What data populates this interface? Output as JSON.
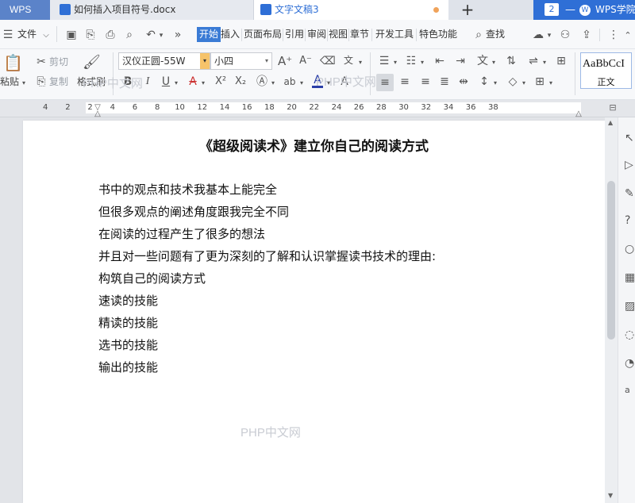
{
  "titlebar": {
    "app_logo": "WPS",
    "tabs": [
      {
        "label": "如何插入项目符号.docx",
        "icon": "wps-writer-doc-icon"
      },
      {
        "label": "文字文稿3",
        "icon": "wps-writer-doc-icon",
        "active": true,
        "unsaved": true
      }
    ],
    "new_tab": "+",
    "tab_count": "2",
    "academy": "WPS学院"
  },
  "menubar": {
    "file": "文件",
    "items": [
      "开始",
      "插入",
      "页面布局",
      "引用",
      "审阅",
      "视图",
      "章节",
      "开发工具",
      "特色功能"
    ],
    "active": "开始",
    "search": "查找"
  },
  "ribbon": {
    "paste": "粘贴",
    "cut": "剪切",
    "copy": "复制",
    "format_painter": "格式刷",
    "font_name": "汉仪正圆-55W",
    "font_size": "小四",
    "style_sample": "AaBbCcI",
    "style_name": "正文"
  },
  "watermark": "PHP中文网",
  "ruler": {
    "numbers": [
      "4",
      "2",
      "2",
      "4",
      "6",
      "8",
      "10",
      "12",
      "14",
      "16",
      "18",
      "20",
      "22",
      "24",
      "26",
      "28",
      "30",
      "32",
      "34",
      "36",
      "38"
    ]
  },
  "document": {
    "title": "《超级阅读术》建立你自己的阅读方式",
    "lines": [
      "书中的观点和技术我基本上能完全",
      "但很多观点的阐述角度跟我完全不同",
      "在阅读的过程产生了很多的想法",
      "并且对一些问题有了更为深刻的了解和认识掌握读书技术的理由:",
      "构筑自己的阅读方式",
      "速读的技能",
      "精读的技能",
      "选书的技能",
      "输出的技能"
    ]
  },
  "colors": {
    "accent": "#2f6fd6",
    "active_tab_bg": "#3a7bd5"
  }
}
